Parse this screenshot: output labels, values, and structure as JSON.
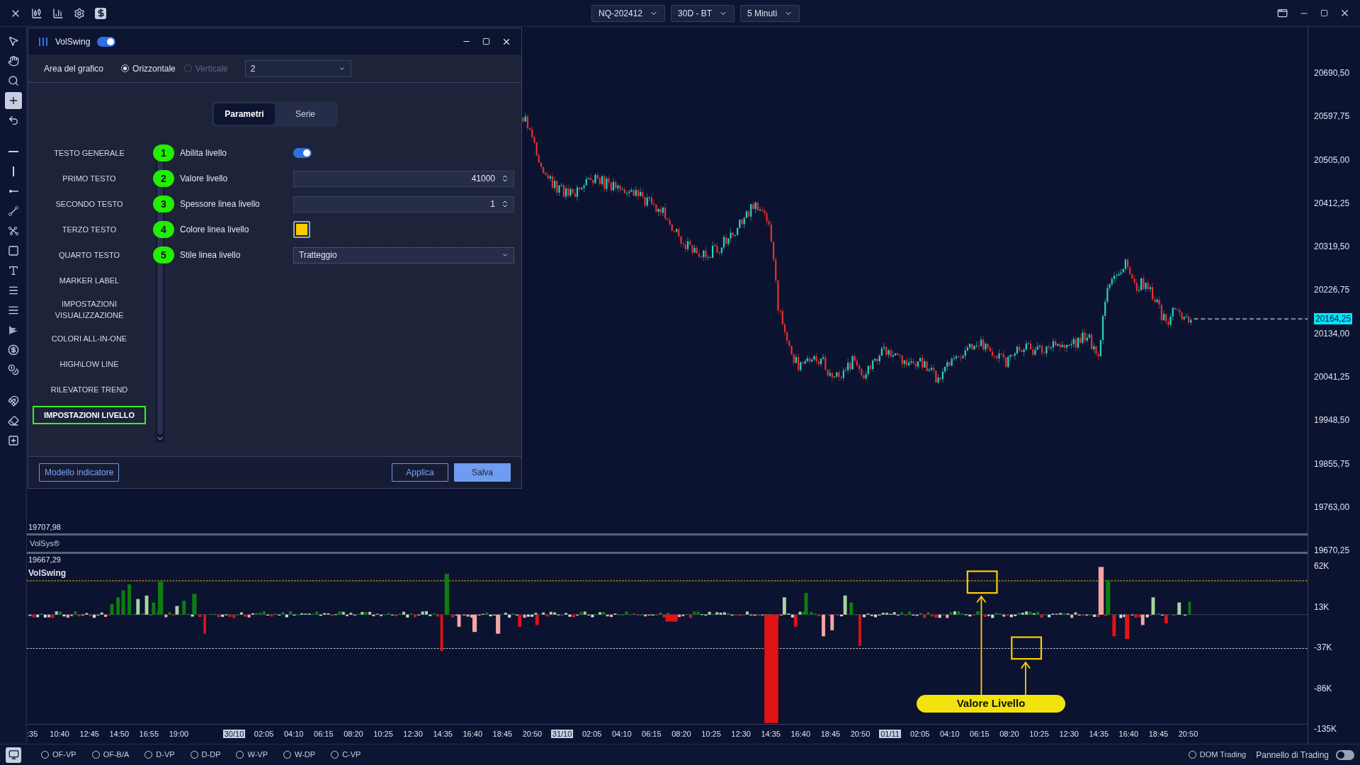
{
  "top_bar": {
    "symbol": "NQ-202412",
    "period": "30D - BT",
    "interval": "5 Minuti"
  },
  "left_toolbar": {
    "tools": [
      {
        "selected": false
      },
      {
        "selected": false
      },
      {
        "selected": false
      },
      {
        "selected": true
      },
      {
        "selected": false
      },
      {
        "selected": false
      },
      {
        "selected": false
      },
      {
        "selected": false
      },
      {
        "selected": false
      },
      {
        "selected": false
      },
      {
        "selected": false
      },
      {
        "selected": false
      },
      {
        "selected": false
      },
      {
        "selected": false
      },
      {
        "selected": false
      },
      {
        "selected": false
      },
      {
        "selected": false
      },
      {
        "selected": false
      },
      {
        "selected": false
      },
      {
        "selected": false
      }
    ]
  },
  "price_axis": {
    "labels": [
      "20690,50",
      "20597,75",
      "20505,00",
      "20412,25",
      "20319,50",
      "20226,75",
      "20134,00",
      "20041,25",
      "19948,50",
      "19855,75",
      "19763,00",
      "19670,25"
    ],
    "current_price": "20164,25"
  },
  "chart": {
    "low_label": "19707,98"
  },
  "indicator_separator": {
    "title": "VolSys®"
  },
  "indicator_pane": {
    "value": "19667,29",
    "title": "VolSwing",
    "axis_labels": [
      "62K",
      "13K",
      "-37K",
      "-86K",
      "-135K"
    ],
    "annotation": "Valore Livello"
  },
  "time_axis": [
    {
      "label": ":35",
      "kind": "cut"
    },
    {
      "label": "10:40",
      "kind": "time"
    },
    {
      "label": "12:45",
      "kind": "time"
    },
    {
      "label": "14:50",
      "kind": "time"
    },
    {
      "label": "16:55",
      "kind": "time"
    },
    {
      "label": "19:00",
      "kind": "time"
    },
    {
      "label": "30/10",
      "kind": "date"
    },
    {
      "label": "02:05",
      "kind": "time"
    },
    {
      "label": "04:10",
      "kind": "time"
    },
    {
      "label": "06:15",
      "kind": "time"
    },
    {
      "label": "08:20",
      "kind": "time"
    },
    {
      "label": "10:25",
      "kind": "time"
    },
    {
      "label": "12:30",
      "kind": "time"
    },
    {
      "label": "14:35",
      "kind": "time"
    },
    {
      "label": "16:40",
      "kind": "time"
    },
    {
      "label": "18:45",
      "kind": "time"
    },
    {
      "label": "20:50",
      "kind": "time"
    },
    {
      "label": "31/10",
      "kind": "date"
    },
    {
      "label": "02:05",
      "kind": "time"
    },
    {
      "label": "04:10",
      "kind": "time"
    },
    {
      "label": "06:15",
      "kind": "time"
    },
    {
      "label": "08:20",
      "kind": "time"
    },
    {
      "label": "10:25",
      "kind": "time"
    },
    {
      "label": "12:30",
      "kind": "time"
    },
    {
      "label": "14:35",
      "kind": "time"
    },
    {
      "label": "16:40",
      "kind": "time"
    },
    {
      "label": "18:45",
      "kind": "time"
    },
    {
      "label": "20:50",
      "kind": "time"
    },
    {
      "label": "01/11",
      "kind": "date"
    },
    {
      "label": "02:05",
      "kind": "time"
    },
    {
      "label": "04:10",
      "kind": "time"
    },
    {
      "label": "06:15",
      "kind": "time"
    },
    {
      "label": "08:20",
      "kind": "time"
    },
    {
      "label": "10:25",
      "kind": "time"
    },
    {
      "label": "12:30",
      "kind": "time"
    },
    {
      "label": "14:35",
      "kind": "time"
    },
    {
      "label": "16:40",
      "kind": "time"
    },
    {
      "label": "18:45",
      "kind": "time"
    },
    {
      "label": "20:50",
      "kind": "time"
    }
  ],
  "bottom_bar": {
    "options": [
      {
        "label": "OF-VP",
        "selected": false
      },
      {
        "label": "OF-B/A",
        "selected": false
      },
      {
        "label": "D-VP",
        "selected": false
      },
      {
        "label": "D-DP",
        "selected": false
      },
      {
        "label": "W-VP",
        "selected": false
      },
      {
        "label": "W-DP",
        "selected": false
      },
      {
        "label": "C-VP",
        "selected": false
      }
    ],
    "dom_trading": {
      "label": "DOM Trading",
      "selected": false
    },
    "trading_panel": {
      "label": "Pannello di Trading",
      "on": false
    }
  },
  "dialog": {
    "title": "VolSwing",
    "enabled": true,
    "chart_area": {
      "label": "Area del grafico",
      "options": [
        {
          "label": "Orizzontale",
          "selected": true,
          "disabled": false
        },
        {
          "label": "Verticale",
          "selected": false,
          "disabled": true
        }
      ],
      "pane_select": "2"
    },
    "tabs": [
      {
        "label": "Parametri",
        "selected": true
      },
      {
        "label": "Serie",
        "selected": false
      }
    ],
    "sections": [
      {
        "label": "TESTO GENERALE",
        "selected": false
      },
      {
        "label": "PRIMO TESTO",
        "selected": false
      },
      {
        "label": "SECONDO TESTO",
        "selected": false
      },
      {
        "label": "TERZO TESTO",
        "selected": false
      },
      {
        "label": "QUARTO TESTO",
        "selected": false
      },
      {
        "label": "MARKER LABEL",
        "selected": false
      },
      {
        "label": "IMPOSTAZIONI VISUALIZZAZIONE",
        "selected": false
      },
      {
        "label": "COLORI ALL-IN-ONE",
        "selected": false
      },
      {
        "label": "HIGH\\LOW LINE",
        "selected": false
      },
      {
        "label": "RILEVATORE TREND",
        "selected": false
      },
      {
        "label": "IMPOSTAZIONI LIVELLO",
        "selected": true
      }
    ],
    "parameters": [
      {
        "number": "1",
        "label": "Abilita livello",
        "kind": "toggle",
        "on": true
      },
      {
        "number": "2",
        "label": "Valore livello",
        "kind": "number",
        "value": "41000"
      },
      {
        "number": "3",
        "label": "Spessore linea livello",
        "kind": "number",
        "value": "1"
      },
      {
        "number": "4",
        "label": "Colore linea livello",
        "kind": "color",
        "color": "#ffcc00"
      },
      {
        "number": "5",
        "label": "Stile linea livello",
        "kind": "select",
        "value": "Tratteggio"
      }
    ],
    "buttons": {
      "template": "Modello indicatore",
      "apply": "Applica",
      "save": "Salva"
    }
  }
}
